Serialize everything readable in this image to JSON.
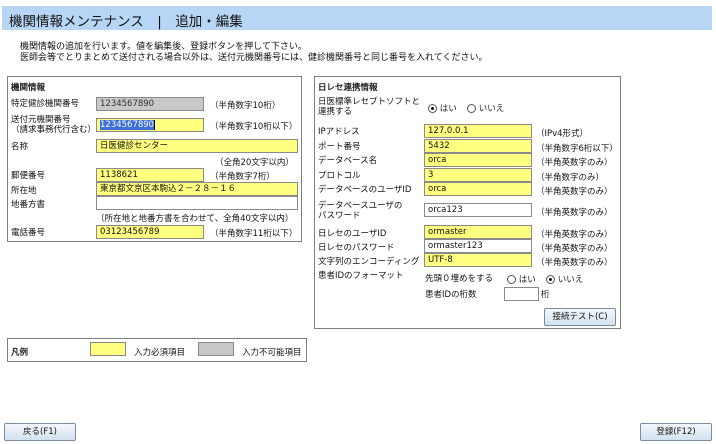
{
  "header": {
    "title": "機関情報メンテナンス　|　追加・編集"
  },
  "intro": {
    "line1": "機関情報の追加を行います。値を編集後、登録ボタンを押して下さい。",
    "line2": "医師会等でとりまとめて送付される場合以外は、送付元機関番号には、健診機関番号と同じ番号を入れてください。"
  },
  "org_panel": {
    "title": "機関情報",
    "kenshin_no": {
      "label": "特定健診機関番号",
      "value": "1234567890",
      "note": "（半角数字10桁）"
    },
    "sender_no": {
      "label_line1": "送付元機関番号",
      "label_line2": "（請求事務代行含む）",
      "value": "1234567890",
      "note": "（半角数字10桁以下）"
    },
    "name": {
      "label": "名称",
      "value": "日医健診センター",
      "note": "（全角20文字以内）"
    },
    "postal": {
      "label": "郵便番号",
      "value": "1138621",
      "note": "（半角数字7桁）"
    },
    "address": {
      "label": "所在地",
      "value": "東京都文京区本駒込２－２８－１６"
    },
    "banchi": {
      "label": "地番方書",
      "value": "",
      "note": "（所在地と地番方書を合わせて、全角40文字以内）"
    },
    "phone": {
      "label": "電話番号",
      "value": "03123456789",
      "note": "（半角数字11桁以下）"
    }
  },
  "orca_panel": {
    "title": "日レセ連携情報",
    "link": {
      "label_line1": "日医標準レセプトソフトと",
      "label_line2": "連携する",
      "yes": "はい",
      "no": "いいえ",
      "selected": "はい"
    },
    "ip": {
      "label": "IPアドレス",
      "value": "127.0.0.1",
      "note": "（IPv4形式）"
    },
    "port": {
      "label": "ポート番号",
      "value": "5432",
      "note": "（半角数字6桁以下）"
    },
    "dbname": {
      "label": "データベース名",
      "value": "orca",
      "note": "（半角英数字のみ）"
    },
    "protocol": {
      "label": "プロトコル",
      "value": "3",
      "note": "（半角数字のみ）"
    },
    "dbuser": {
      "label": "データベースのユーザID",
      "value": "orca",
      "note": "（半角英数字のみ）"
    },
    "dbpass": {
      "label_line1": "データベースユーザの",
      "label_line2": "パスワード",
      "value": "orca123",
      "note": "（半角英数字のみ）"
    },
    "orca_user": {
      "label": "日レセのユーザID",
      "value": "ormaster",
      "note": "（半角英数字のみ）"
    },
    "orca_pass": {
      "label": "日レセのパスワード",
      "value": "ormaster123",
      "note": "（半角英数字のみ）"
    },
    "encoding": {
      "label": "文字列のエンコーディング",
      "value": "UTF-8",
      "note": "（半角英数字のみ）"
    },
    "pid_format": {
      "label": "患者IDのフォーマット",
      "zero_label": "先頭０埋めをする",
      "yes": "はい",
      "no": "いいえ",
      "selected": "いいえ",
      "digits_label": "患者IDの桁数",
      "digits_value": "",
      "digits_unit": "桁"
    },
    "test_button": "接続テスト(C)"
  },
  "legend": {
    "title": "凡例",
    "required": "入力必須項目",
    "readonly": "入力不可能項目"
  },
  "footer": {
    "back": "戻る(F1)",
    "register": "登録(F12)"
  },
  "colors": {
    "header_bg": "#b7d6f5",
    "required_bg": "#ffff80",
    "readonly_bg": "#c8c8c8"
  }
}
